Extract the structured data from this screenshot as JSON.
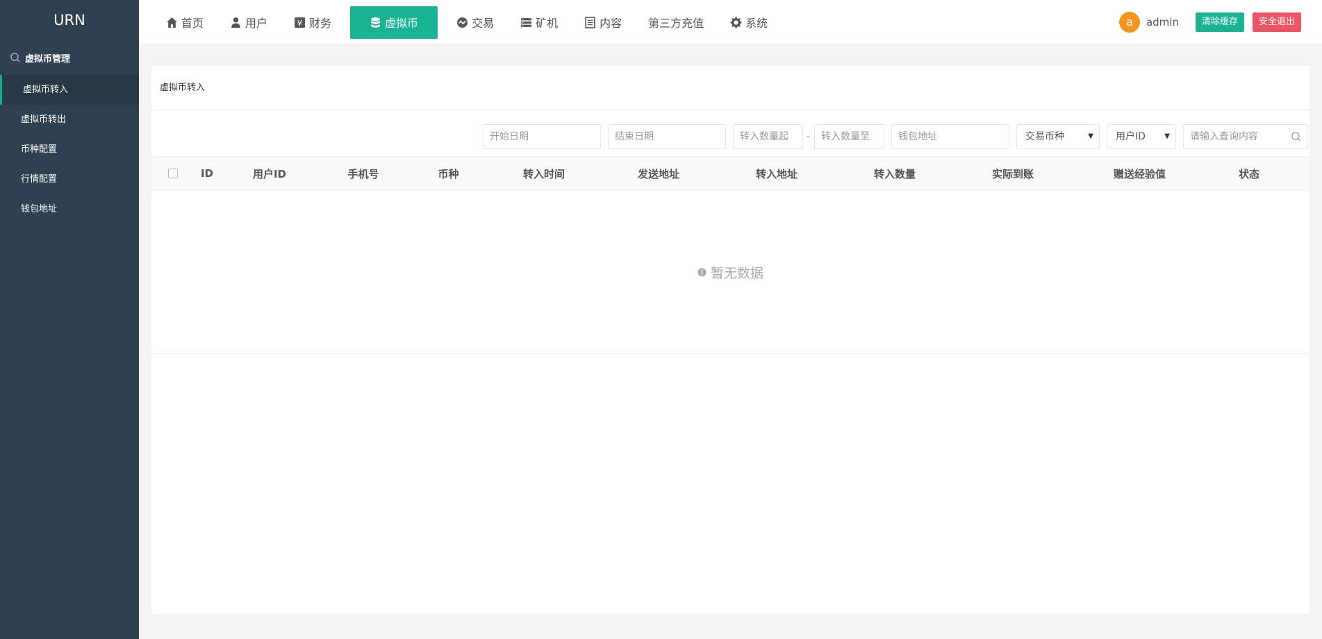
{
  "app": {
    "brand": "URN"
  },
  "sidebar": {
    "group_label": "虚拟币管理",
    "items": [
      {
        "label": "虚拟币转入",
        "active": true
      },
      {
        "label": "虚拟币转出"
      },
      {
        "label": "币种配置"
      },
      {
        "label": "行情配置"
      },
      {
        "label": "钱包地址"
      }
    ]
  },
  "topnav": {
    "items": [
      {
        "label": "首页",
        "icon": "home-icon"
      },
      {
        "label": "用户",
        "icon": "user-icon"
      },
      {
        "label": "财务",
        "icon": "yen-icon"
      },
      {
        "label": "虚拟币",
        "icon": "database-icon",
        "active": true
      },
      {
        "label": "交易",
        "icon": "exchange-icon"
      },
      {
        "label": "矿机",
        "icon": "server-icon"
      },
      {
        "label": "内容",
        "icon": "document-icon"
      },
      {
        "label": "第三方充值"
      },
      {
        "label": "系统",
        "icon": "gear-icon"
      }
    ]
  },
  "user": {
    "avatar_letter": "a",
    "name": "admin",
    "clear_cache_label": "清除缓存",
    "logout_label": "安全退出"
  },
  "panel": {
    "title": "虚拟币转入"
  },
  "filters": {
    "start_date_placeholder": "开始日期",
    "end_date_placeholder": "结束日期",
    "amount_from_placeholder": "转入数量起",
    "amount_dash": "-",
    "amount_to_placeholder": "转入数量至",
    "wallet_placeholder": "钱包地址",
    "currency_select": "交易币种",
    "field_select": "用户ID",
    "search_placeholder": "请输入查询内容"
  },
  "table": {
    "columns": [
      "ID",
      "用户ID",
      "手机号",
      "币种",
      "转入时间",
      "发送地址",
      "转入地址",
      "转入数量",
      "实际到账",
      "赠送经验值",
      "状态"
    ],
    "empty_text": "暂无数据"
  },
  "colors": {
    "sidebar_bg": "#2f4050",
    "accent": "#1ab394",
    "danger": "#ed5565",
    "avatar": "#f7941d"
  }
}
